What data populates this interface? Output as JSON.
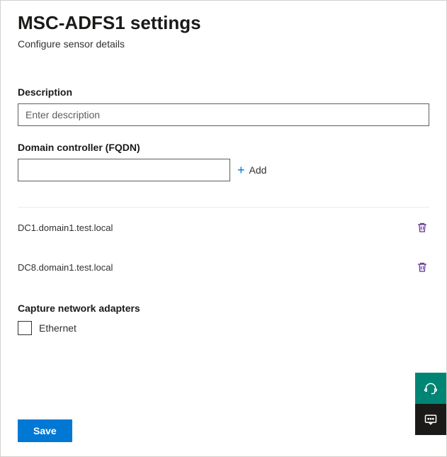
{
  "header": {
    "title": "MSC-ADFS1 settings",
    "subtitle": "Configure sensor details"
  },
  "description": {
    "label": "Description",
    "placeholder": "Enter description",
    "value": ""
  },
  "fqdn": {
    "label": "Domain controller (FQDN)",
    "value": "",
    "addLabel": "Add"
  },
  "domainControllers": [
    {
      "name": "DC1.domain1.test.local"
    },
    {
      "name": "DC8.domain1.test.local"
    }
  ],
  "adapters": {
    "label": "Capture network adapters",
    "items": [
      {
        "name": "Ethernet",
        "checked": false
      }
    ]
  },
  "actions": {
    "save": "Save"
  }
}
